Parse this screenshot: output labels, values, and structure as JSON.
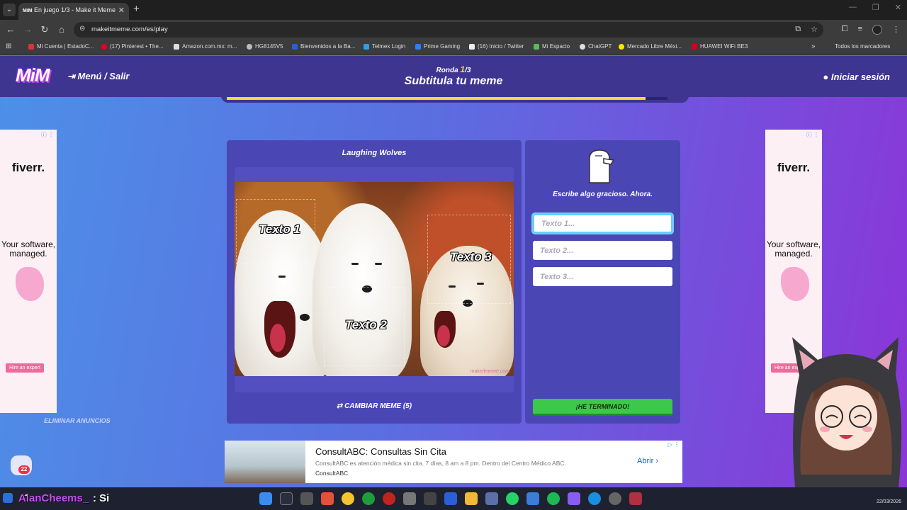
{
  "browser": {
    "tab_title": "En juego 1/3 - Make it Meme",
    "tab_favicon": "MiM",
    "url": "makeitmeme.com/es/play",
    "bookmarks": [
      {
        "label": "Mi Cuenta | EstadoC...",
        "color": "#d33"
      },
      {
        "label": "(17) Pinterest • The...",
        "color": "#e60023"
      },
      {
        "label": "Amazon.com.mx: m...",
        "color": "#ddd"
      },
      {
        "label": "HG8145V5",
        "color": "#bbb"
      },
      {
        "label": "Bienvenidos a la Ba...",
        "color": "#2b5fd8"
      },
      {
        "label": "Telmex Login",
        "color": "#2ea0e0"
      },
      {
        "label": "Prime Gaming",
        "color": "#2a7fff"
      },
      {
        "label": "(16) Inicio / Twitter",
        "color": "#eee"
      },
      {
        "label": "Mi Espacio",
        "color": "#5cb85c"
      },
      {
        "label": "ChatGPT",
        "color": "#ddd"
      },
      {
        "label": "Mercado Libre Méxi...",
        "color": "#ffe600"
      },
      {
        "label": "HUAWEI WiFi BE3",
        "color": "#d0021b"
      }
    ],
    "all_bookmarks": "Todos los marcadores"
  },
  "header": {
    "logo": "MiM",
    "menu": "Menú / Salir",
    "round_prefix": "Ronda ",
    "round_current": "1",
    "round_total": "/3",
    "title": "Subtitula tu meme",
    "login": "Iniciar sesión",
    "progress": 0.95
  },
  "side_ads": {
    "brand": "fiverr.",
    "copy": "Your software, managed.",
    "cta": "Hire an expert",
    "remove": "ELIMINAR ANUNCIOS"
  },
  "meme": {
    "name": "Laughing Wolves",
    "text1": "Texto 1",
    "text2": "Texto 2",
    "text3": "Texto 3",
    "watermark": "makeitmeme.com",
    "change": "CAMBIAR MEME (5)"
  },
  "captions": {
    "prompt": "Escribe algo gracioso. Ahora.",
    "placeholder1": "Texto 1...",
    "placeholder2": "Texto 2...",
    "placeholder3": "Texto 3...",
    "done": "¡HE TERMINADO!"
  },
  "bottom_ad": {
    "title": "ConsultABC: Consultas Sin Cita",
    "desc": "ConsultABC es atención médica sin cita. 7 días, 8 am a 8 pm. Dentro del Centro Médico ABC.",
    "brand": "ConsultABC",
    "open": "Abrir"
  },
  "chat": {
    "count": "22"
  },
  "stream": {
    "name": "AlanCheems_",
    "message": ": Si"
  },
  "taskbar": {
    "date": "22/03/2026"
  }
}
